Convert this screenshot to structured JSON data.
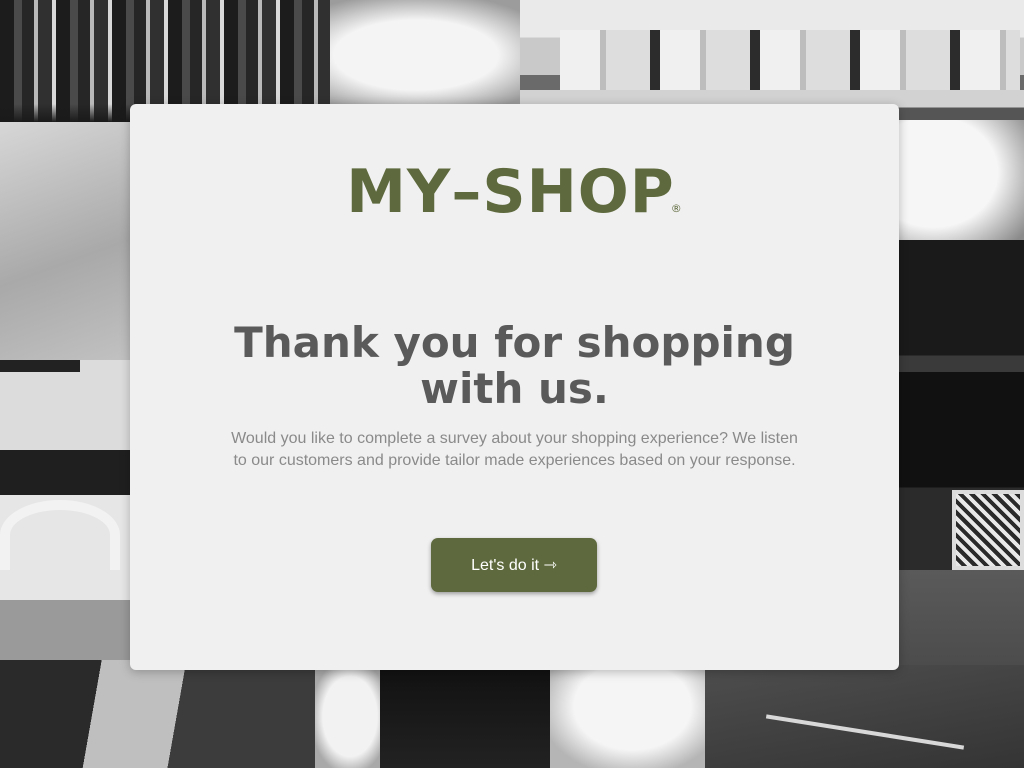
{
  "colors": {
    "brand": "#5e6a3d",
    "card_background": "#f0f0f0",
    "headline_text": "#5a5a5a",
    "body_text": "#8a8a8a"
  },
  "logo": {
    "text": "MY–SHOP",
    "registered_mark": "®"
  },
  "headline": {
    "line1": "Thank you for shopping",
    "line2": "with us."
  },
  "description": "Would you like to complete a survey about your shopping experience? We listen to our customers and provide tailor made experiences based on your response.",
  "cta": {
    "label": "Let's do it ⇾"
  }
}
